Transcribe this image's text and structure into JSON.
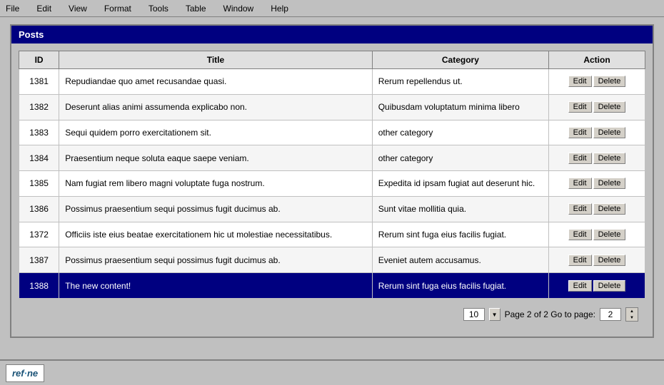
{
  "menubar": {
    "items": [
      "File",
      "Edit",
      "View",
      "Format",
      "Tools",
      "Table",
      "Window",
      "Help"
    ]
  },
  "panel": {
    "title": "Posts"
  },
  "table": {
    "columns": [
      "ID",
      "Title",
      "Category",
      "Action"
    ],
    "rows": [
      {
        "id": "1381",
        "title": "Repudiandae quo amet recusandae quasi.",
        "category": "Rerum repellendus ut.",
        "selected": false
      },
      {
        "id": "1382",
        "title": "Deserunt alias animi assumenda explicabo non.",
        "category": "Quibusdam voluptatum minima libero",
        "selected": false
      },
      {
        "id": "1383",
        "title": "Sequi quidem porro exercitationem sit.",
        "category": "other category",
        "selected": false
      },
      {
        "id": "1384",
        "title": "Praesentium neque soluta eaque saepe veniam.",
        "category": "other category",
        "selected": false
      },
      {
        "id": "1385",
        "title": "Nam fugiat rem libero magni voluptate fuga nostrum.",
        "category": "Expedita id ipsam fugiat aut deserunt hic.",
        "selected": false
      },
      {
        "id": "1386",
        "title": "Possimus praesentium sequi possimus fugit ducimus ab.",
        "category": "Sunt vitae mollitia quia.",
        "selected": false
      },
      {
        "id": "1372",
        "title": "Officiis iste eius beatae exercitationem hic ut molestiae necessitatibus.",
        "category": "Rerum sint fuga eius facilis fugiat.",
        "selected": false
      },
      {
        "id": "1387",
        "title": "Possimus praesentium sequi possimus fugit ducimus ab.",
        "category": "Eveniet autem accusamus.",
        "selected": false
      },
      {
        "id": "1388",
        "title": "The new content!",
        "category": "Rerum sint fuga eius facilis fugiat.",
        "selected": true
      }
    ],
    "btn_edit": "Edit",
    "btn_delete": "Delete"
  },
  "pagination": {
    "page_size": "10",
    "page_info": "Page 2 of 2  Go to page:",
    "goto_value": "2"
  },
  "footer": {
    "logo": "ref·ne"
  }
}
